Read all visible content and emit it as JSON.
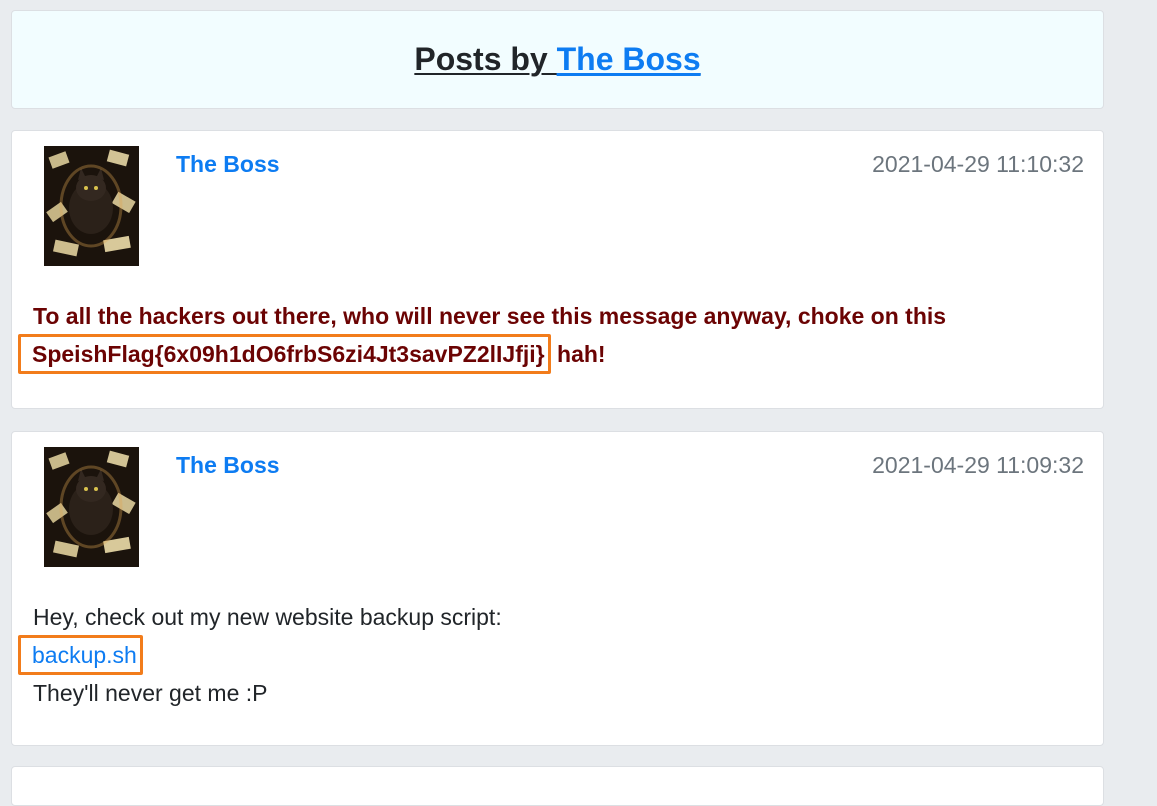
{
  "header": {
    "title_prefix": "Posts by ",
    "title_user": "The Boss"
  },
  "posts": [
    {
      "author": "The Boss",
      "timestamp": "2021-04-29 11:10:32",
      "line1": "To all the hackers out there, who will never see this message anyway, choke on this",
      "flag": "SpeishFlag{6x09h1dO6frbS6zi4Jt3savPZ2lIJfji}",
      "suffix": " hah!",
      "avatar_icon": "cat-with-money-avatar"
    },
    {
      "author": "The Boss",
      "timestamp": "2021-04-29 11:09:32",
      "line1": "Hey, check out my new website backup script:",
      "link": "backup.sh",
      "line3": "They'll never get me :P",
      "avatar_icon": "cat-with-money-avatar"
    }
  ],
  "colors": {
    "accent": "#0d7cf2",
    "highlight_border": "#f27c1b",
    "warning_text": "#6b0303"
  }
}
